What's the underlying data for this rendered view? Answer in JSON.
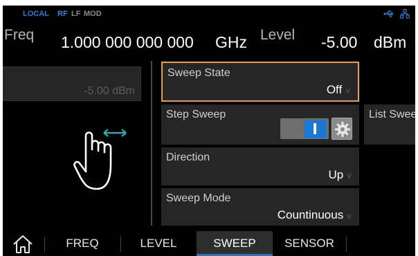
{
  "status": {
    "local": "LOCAL",
    "rf": "RF",
    "lf": "LF",
    "mod": "MOD",
    "usb_icon": "usb-icon",
    "network_icon": "network-icon"
  },
  "header": {
    "freq_label": "Freq",
    "freq_value": "1.000 000 000 000",
    "freq_unit": "GHz",
    "level_label": "Level",
    "level_value": "-5.00",
    "level_unit": "dBm"
  },
  "side": {
    "level_field": "-5.00 dBm",
    "gesture_icon": "swipe-hand-icon"
  },
  "sweep": {
    "state_label": "Sweep State",
    "state_value": "Off",
    "step_label": "Step Sweep",
    "step_toggle_on": true,
    "list_label": "List Sweep",
    "direction_label": "Direction",
    "direction_value": "Up",
    "mode_label": "Sweep Mode",
    "mode_value": "Countinuous"
  },
  "nav": {
    "home_icon": "home-icon",
    "items": [
      "FREQ",
      "LEVEL",
      "SWEEP",
      "SENSOR"
    ],
    "active": "SWEEP"
  },
  "colors": {
    "accent_blue": "#1a78d4",
    "focus_orange": "#e8a23a",
    "background": "#000000",
    "cell": "#262626"
  }
}
